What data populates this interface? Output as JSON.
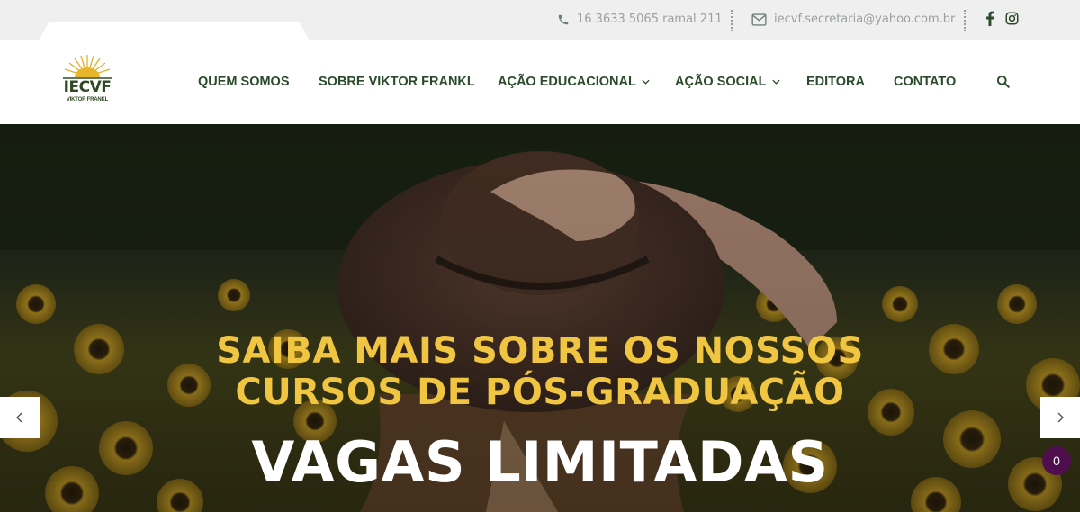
{
  "topbar": {
    "phone": "16 3633 5065 ramal 211",
    "email": "iecvf.secretaria@yahoo.com.br",
    "social": [
      {
        "icon": "facebook-icon"
      },
      {
        "icon": "instagram-icon"
      }
    ]
  },
  "logo": {
    "text": "IECVF",
    "sub": "VIKTOR FRANKL"
  },
  "nav": {
    "items": [
      {
        "label": "QUEM SOMOS"
      },
      {
        "label": "SOBRE VIKTOR FRANKL"
      },
      {
        "label": "AÇÃO EDUCACIONAL",
        "dropdown": true
      },
      {
        "label": "AÇÃO SOCIAL",
        "dropdown": true
      },
      {
        "label": "EDITORA"
      },
      {
        "label": "CONTATO"
      }
    ],
    "search_icon": "search-icon"
  },
  "hero": {
    "line1": "SAIBA MAIS SOBRE OS NOSSOS",
    "line2": "CURSOS DE PÓS-GRADUAÇÃO",
    "line3": "VAGAS LIMITADAS",
    "prev": "‹",
    "next": "›"
  },
  "badge": {
    "count": "0"
  },
  "colors": {
    "nav_text": "#2b4a2b",
    "headline": "#f0c542",
    "badge": "#4f0f4f",
    "topbar_bg": "#efefef"
  }
}
